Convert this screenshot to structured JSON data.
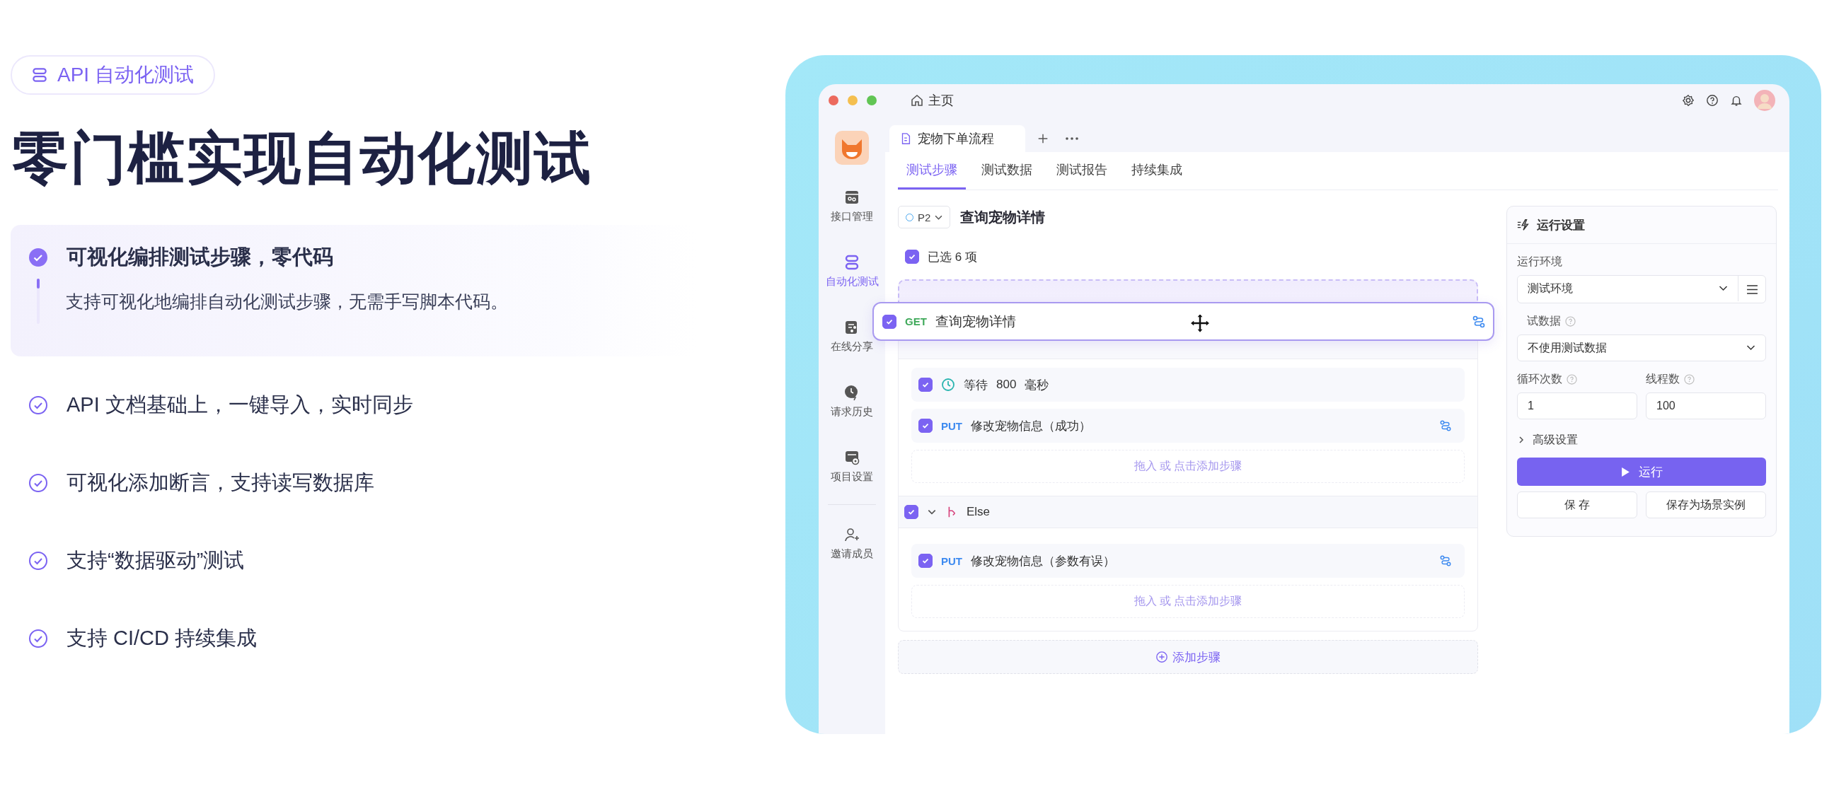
{
  "badge": {
    "label": "API 自动化测试"
  },
  "headline": "零门槛实现自动化测试",
  "features": [
    {
      "title": "可视化编排测试步骤，零代码",
      "description": "支持可视化地编排自动化测试步骤，无需手写脚本代码。",
      "selected": true
    },
    {
      "title": "API 文档基础上，一键导入，实时同步",
      "selected": false
    },
    {
      "title": "可视化添加断言，支持读写数据库",
      "selected": false
    },
    {
      "title": "支持“数据驱动”测试",
      "selected": false
    },
    {
      "title": "支持 CI/CD 持续集成",
      "selected": false
    }
  ],
  "window": {
    "breadcrumb": "主页"
  },
  "sidebar": {
    "items": [
      {
        "label": "接口管理",
        "selected": false
      },
      {
        "label": "自动化测试",
        "selected": true
      },
      {
        "label": "在线分享",
        "selected": false
      },
      {
        "label": "请求历史",
        "selected": false
      },
      {
        "label": "项目设置",
        "selected": false
      }
    ],
    "footer_item": {
      "label": "邀请成员"
    }
  },
  "file_tabs": [
    {
      "label": "宠物下单流程",
      "selected": true
    }
  ],
  "tabs": [
    {
      "label": "测试步骤",
      "selected": true
    },
    {
      "label": "测试数据",
      "selected": false
    },
    {
      "label": "测试报告",
      "selected": false
    },
    {
      "label": "持续集成",
      "selected": false
    }
  ],
  "scenario": {
    "priority": "P2",
    "name": "查询宠物详情"
  },
  "select_all": {
    "label": "已选 6 项",
    "checked": true
  },
  "dragged_step": {
    "method": "GET",
    "color": "#3fa95a",
    "name": "查询宠物详情",
    "checked": true
  },
  "steps": [
    {
      "kind": "wait",
      "checked": true,
      "label": "等待",
      "value": "800",
      "unit": "毫秒"
    },
    {
      "kind": "request",
      "checked": true,
      "method": "PUT",
      "color": "#3d8af0",
      "name": "修改宠物信息（成功）"
    },
    {
      "kind": "dropzone",
      "label": "拖入 或 点击添加步骤"
    },
    {
      "kind": "else",
      "checked": true,
      "expanded": true,
      "label": "Else"
    },
    {
      "kind": "request",
      "checked": true,
      "method": "PUT",
      "color": "#3d8af0",
      "name": "修改宠物信息（参数有误）"
    },
    {
      "kind": "dropzone",
      "label": "拖入 或 点击添加步骤"
    }
  ],
  "add_step": "添加步骤",
  "run_settings": {
    "title": "运行设置",
    "environment_label": "运行环境",
    "environment": "测试环境",
    "test_data_label": "试数据",
    "test_data": "不使用测试数据",
    "loops_label": "循环次数",
    "loops": "1",
    "threads_label": "线程数",
    "threads": "100",
    "advanced": "高级设置",
    "advanced_expanded": false,
    "run": "运行",
    "save": "保 存",
    "save_as": "保存为场景实例"
  }
}
